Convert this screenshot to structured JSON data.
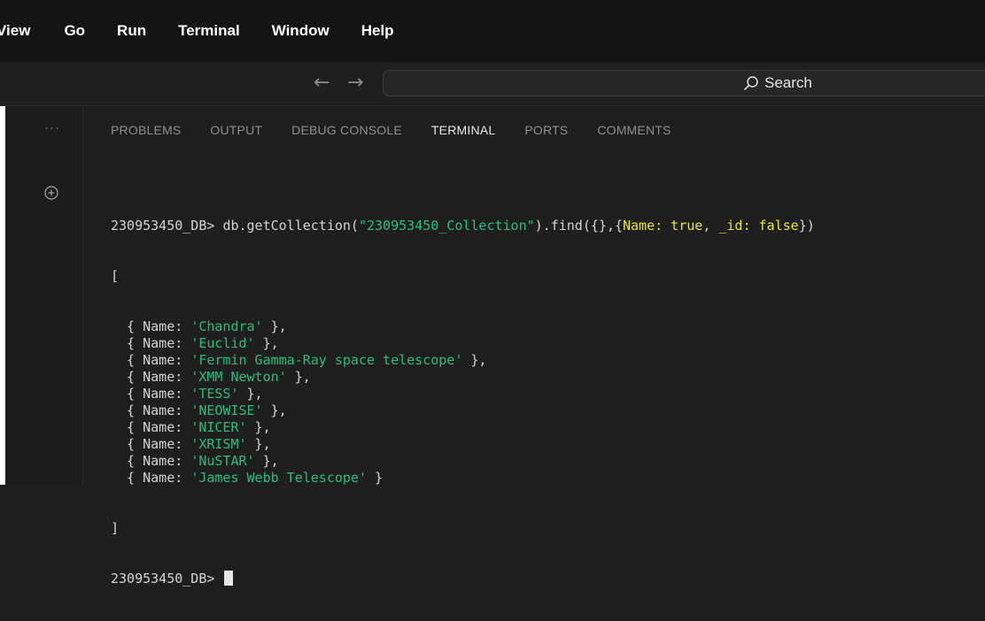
{
  "menubar": {
    "items": [
      "View",
      "Go",
      "Run",
      "Terminal",
      "Window",
      "Help"
    ]
  },
  "titlebar": {
    "back_icon": "arrow-left-icon",
    "forward_icon": "arrow-right-icon",
    "search_label": "Search"
  },
  "sidebar": {
    "more_icon": "ellipsis-icon",
    "add_icon": "plus-circle-icon"
  },
  "panel": {
    "tabs": [
      {
        "label": "PROBLEMS",
        "active": false
      },
      {
        "label": "OUTPUT",
        "active": false
      },
      {
        "label": "DEBUG CONSOLE",
        "active": false
      },
      {
        "label": "TERMINAL",
        "active": true
      },
      {
        "label": "PORTS",
        "active": false
      },
      {
        "label": "COMMENTS",
        "active": false
      }
    ]
  },
  "terminal": {
    "prompt": "230953450_DB> ",
    "command_prefix": "db.getCollection(",
    "collection_arg": "\"230953450_Collection\"",
    "command_mid": ").find({},{",
    "projection_name_key": "Name: true",
    "projection_sep": ", ",
    "projection_id_key": "_id: false",
    "command_suffix": "})",
    "open_bracket": "[",
    "close_bracket": "]",
    "field_name": "Name",
    "results": [
      "'Chandra'",
      "'Euclid'",
      "'Fermin Gamma-Ray space telescope'",
      "'XMM Newton'",
      "'TESS'",
      "'NEOWISE'",
      "'NICER'",
      "'XRISM'",
      "'NuSTAR'",
      "'James Webb Telescope'"
    ],
    "final_prompt": "230953450_DB> "
  },
  "colors": {
    "background": "#1e1e1e",
    "menubar": "#141414",
    "string": "#23c07a",
    "keyword_highlight": "#e8e816",
    "text": "#d4d4d4"
  }
}
